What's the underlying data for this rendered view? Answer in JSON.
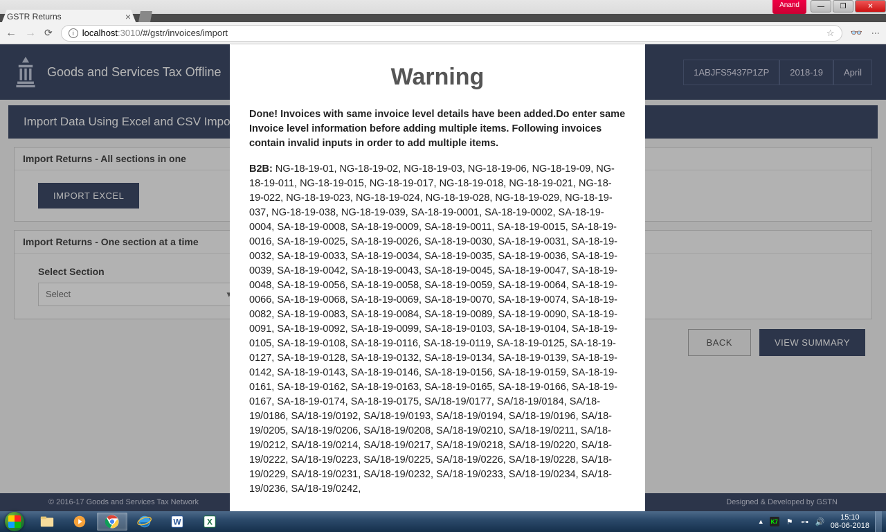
{
  "os_user": "Anand",
  "browser": {
    "tab_title": "GSTR Returns",
    "url_host": "localhost",
    "url_port": ":3010",
    "url_path": "/#/gstr/invoices/import"
  },
  "header": {
    "app_title": "Goods and Services Tax Offline",
    "gstin": "1ABJFS5437P1ZP",
    "fy": "2018-19",
    "month": "April"
  },
  "page": {
    "band_title": "Import Data Using Excel and CSV Import",
    "card1_head": "Import Returns - All sections in one",
    "btn_import": "IMPORT EXCEL",
    "card2_head": "Import Returns - One section at a time",
    "select_label": "Select Section",
    "select_value": "Select",
    "btn_back": "BACK",
    "btn_summary": "VIEW SUMMARY"
  },
  "footer": {
    "left": "© 2016-17 Goods and Services Tax Network",
    "right": "Designed & Developed by GSTN"
  },
  "modal": {
    "title": "Warning",
    "message": "Done! Invoices with same invoice level details have been added.Do enter same Invoice level information before adding multiple items. Following invoices contain invalid inputs in order to add multiple items.",
    "section_label": "B2B",
    "invoices": "NG-18-19-01, NG-18-19-02, NG-18-19-03, NG-18-19-06, NG-18-19-09, NG-18-19-011, NG-18-19-015, NG-18-19-017, NG-18-19-018, NG-18-19-021, NG-18-19-022, NG-18-19-023, NG-18-19-024, NG-18-19-028, NG-18-19-029, NG-18-19-037, NG-18-19-038, NG-18-19-039, SA-18-19-0001, SA-18-19-0002, SA-18-19-0004, SA-18-19-0008, SA-18-19-0009, SA-18-19-0011, SA-18-19-0015, SA-18-19-0016, SA-18-19-0025, SA-18-19-0026, SA-18-19-0030, SA-18-19-0031, SA-18-19-0032, SA-18-19-0033, SA-18-19-0034, SA-18-19-0035, SA-18-19-0036, SA-18-19-0039, SA-18-19-0042, SA-18-19-0043, SA-18-19-0045, SA-18-19-0047, SA-18-19-0048, SA-18-19-0056, SA-18-19-0058, SA-18-19-0059, SA-18-19-0064, SA-18-19-0066, SA-18-19-0068, SA-18-19-0069, SA-18-19-0070, SA-18-19-0074, SA-18-19-0082, SA-18-19-0083, SA-18-19-0084, SA-18-19-0089, SA-18-19-0090, SA-18-19-0091, SA-18-19-0092, SA-18-19-0099, SA-18-19-0103, SA-18-19-0104, SA-18-19-0105, SA-18-19-0108, SA-18-19-0116, SA-18-19-0119, SA-18-19-0125, SA-18-19-0127, SA-18-19-0128, SA-18-19-0132, SA-18-19-0134, SA-18-19-0139, SA-18-19-0142, SA-18-19-0143, SA-18-19-0146, SA-18-19-0156, SA-18-19-0159, SA-18-19-0161, SA-18-19-0162, SA-18-19-0163, SA-18-19-0165, SA-18-19-0166, SA-18-19-0167, SA-18-19-0174, SA-18-19-0175, SA/18-19/0177, SA/18-19/0184, SA/18-19/0186, SA/18-19/0192, SA/18-19/0193, SA/18-19/0194, SA/18-19/0196, SA/18-19/0205, SA/18-19/0206, SA/18-19/0208, SA/18-19/0210, SA/18-19/0211, SA/18-19/0212, SA/18-19/0214, SA/18-19/0217, SA/18-19/0218, SA/18-19/0220, SA/18-19/0222, SA/18-19/0223, SA/18-19/0225, SA/18-19/0226, SA/18-19/0228, SA/18-19/0229, SA/18-19/0231, SA/18-19/0232, SA/18-19/0233, SA/18-19/0234, SA/18-19/0236, SA/18-19/0242,"
  },
  "taskbar": {
    "time": "15:10",
    "date": "08-06-2018"
  }
}
